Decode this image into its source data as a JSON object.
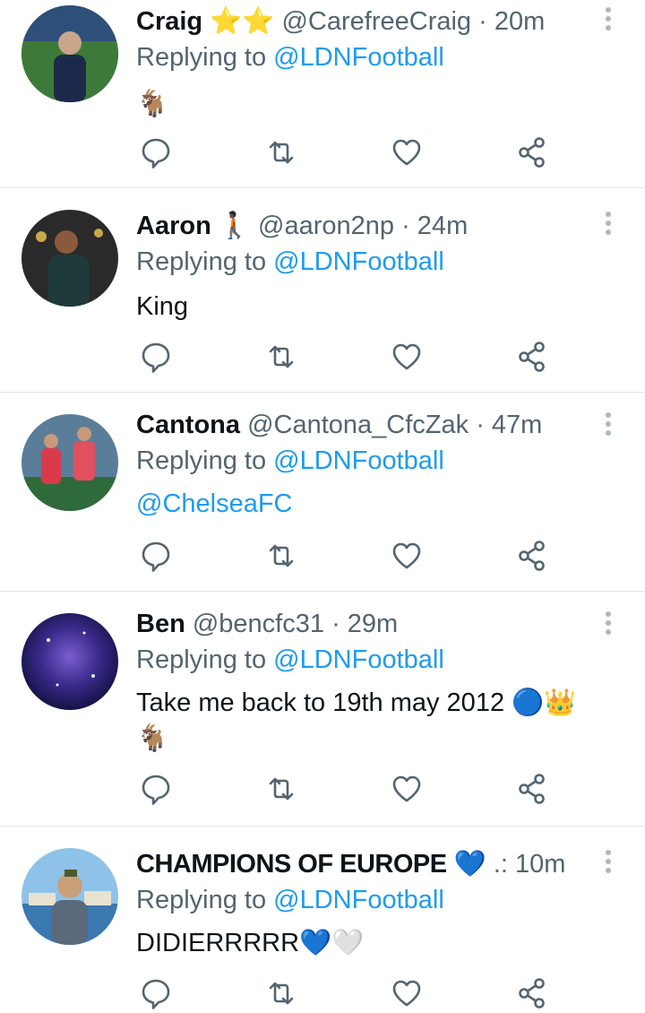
{
  "colors": {
    "link": "#1d9bf0",
    "muted": "#536471",
    "text": "#0f1419",
    "icon": "#536471"
  },
  "reply_prefix": "Replying to",
  "icons": [
    "reply-icon",
    "retweet-icon",
    "like-icon",
    "share-icon",
    "more-icon"
  ],
  "tweets": [
    {
      "name": "Craig",
      "name_suffix": "⭐⭐",
      "handle": "@CarefreeCraig",
      "time": "· 20m",
      "reply_to": "@LDNFootball",
      "text": "🐐",
      "text_line2": ""
    },
    {
      "name": "Aaron",
      "name_suffix": "🚶🏿",
      "handle": "@aaron2np",
      "time": "· 24m",
      "reply_to": "@LDNFootball",
      "text": "King",
      "text_line2": ""
    },
    {
      "name": "Cantona",
      "name_suffix": "",
      "handle": "@Cantona_CfcZak",
      "time": "· 47m",
      "reply_to": "@LDNFootball",
      "text": "@ChelseaFC",
      "text_line2": ""
    },
    {
      "name": "Ben",
      "name_suffix": "",
      "handle": "@bencfc31",
      "time": "· 29m",
      "reply_to": "@LDNFootball",
      "text": "Take me back to 19th may 2012 🔵👑",
      "text_line2": "🐐"
    },
    {
      "name": "CHAMPIONS OF EUROPE",
      "name_suffix": "💙",
      "handle": ".:",
      "time": "10m",
      "reply_to": "@LDNFootball",
      "text": "DIDIERRRRR💙🤍",
      "text_line2": ""
    }
  ]
}
